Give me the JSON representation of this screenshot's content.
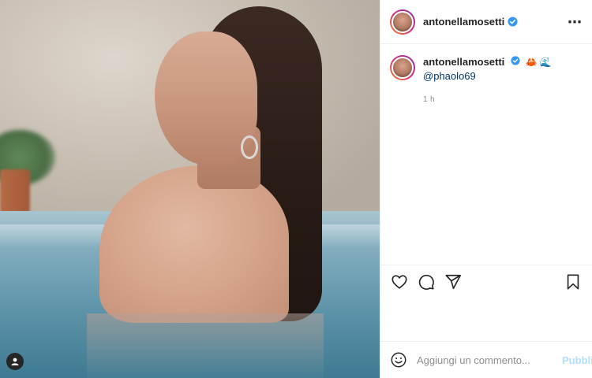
{
  "post": {
    "author": "antonellamosetti",
    "more_icon": "⋯"
  },
  "caption": {
    "username": "antonellamosetti",
    "emojis": [
      "🦀",
      "🌊"
    ],
    "mention": "@phaolo69",
    "time": "1 h"
  },
  "actions": {
    "like_icon": "heart-icon",
    "comment_icon": "comment-icon",
    "share_icon": "paper-plane-icon",
    "save_icon": "bookmark-icon"
  },
  "add_comment": {
    "placeholder": "Aggiungi un commento...",
    "publish_label": "Pubblica"
  },
  "colors": {
    "verified": "#3897f0",
    "link": "#00376b",
    "publish_disabled": "#b2dffc"
  }
}
